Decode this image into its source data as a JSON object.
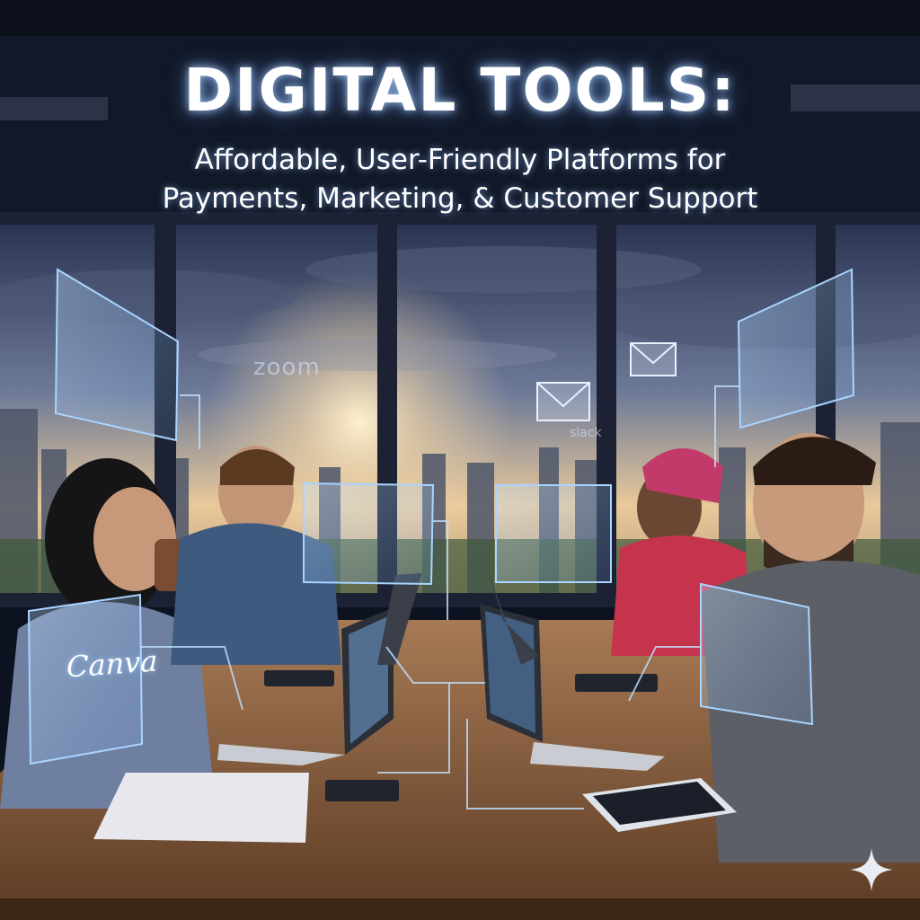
{
  "poster": {
    "title": "DIGITAL TOOLS:",
    "subtitle_line1": "Affordable, User-Friendly Platforms for",
    "subtitle_line2": "Payments, Marketing, & Customer Support"
  },
  "floating_labels": {
    "zoom": "zoom",
    "slack": "slack",
    "canva": "Canva"
  },
  "colors": {
    "sky_top": "#2a3452",
    "sky_glow": "#f6d8a8",
    "hologram": "#a9d4ff",
    "table_wood": "#7a5236",
    "title_text": "#ffffff"
  }
}
